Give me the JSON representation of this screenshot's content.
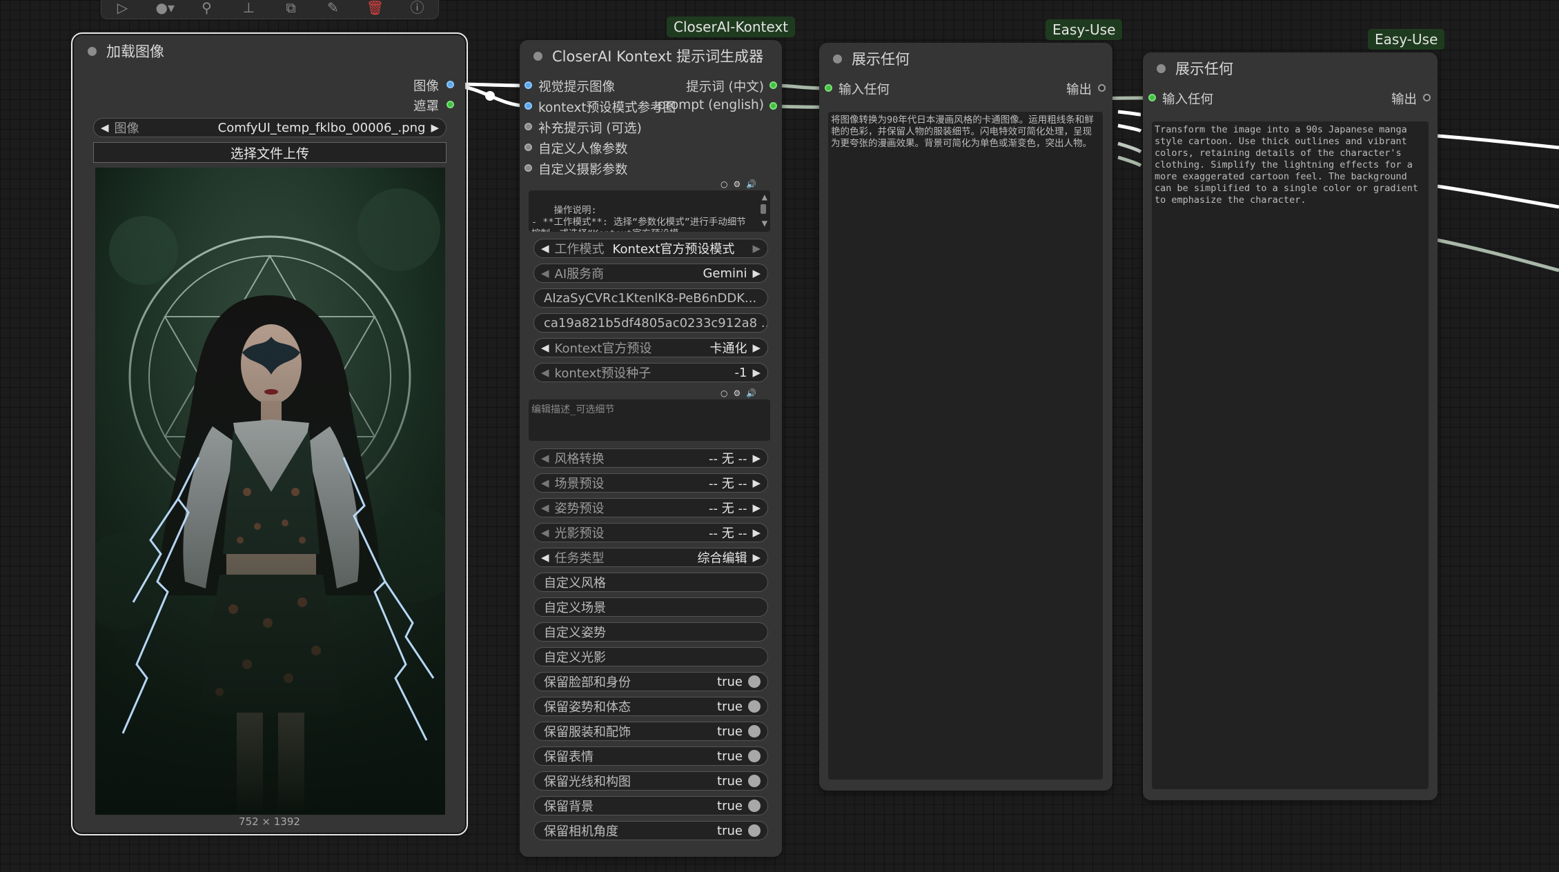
{
  "toolbar": {
    "icons": [
      "play-icon",
      "record-icon",
      "wand-icon",
      "pin-icon",
      "export-icon",
      "pencil-icon",
      "trash-icon",
      "help-icon"
    ]
  },
  "badges": {
    "kontext": "CloserAI-Kontext",
    "easy1": "Easy-Use",
    "easy2": "Easy-Use"
  },
  "load_image": {
    "title": "加载图像",
    "out_image": "图像",
    "out_mask": "遮罩",
    "image_widget_label": "图像",
    "image_widget_value": "ComfyUI_temp_fklbo_00006_.png",
    "upload_button": "选择文件上传",
    "dimensions": "752 × 1392"
  },
  "kontext_node": {
    "title": "CloserAI Kontext 提示词生成器",
    "inputs": [
      "视觉提示图像",
      "kontext预设模式参考图",
      "补充提示词 (可选)",
      "自定义人像参数",
      "自定义摄影参数"
    ],
    "outputs": [
      "提示词 (中文)",
      "prompt (english)"
    ],
    "instructions": "操作说明:\n- **工作模式**: 选择“参数化模式”进行手动细节控制，或选择“Kontext官方预设模",
    "work_mode_label": "工作模式",
    "work_mode_value": "Kontext官方预设模式",
    "ai_provider_label": "AI服务商",
    "ai_provider_value": "Gemini",
    "api_key_value": "AIzaSyCVRc1KtenlK8-PeB6nDDK...",
    "token_value": "ca19a821b5df4805ac0233c912a8 ...",
    "preset_label": "Kontext官方预设",
    "preset_value": "卡通化",
    "seed_label": "kontext预设种子",
    "seed_value": "-1",
    "edit_placeholder": "编辑描述_可选细节",
    "style_label": "风格转换",
    "style_value": "-- 无 --",
    "scene_label": "场景预设",
    "scene_value": "-- 无 --",
    "pose_label": "姿势预设",
    "pose_value": "-- 无 --",
    "light_label": "光影预设",
    "light_value": "-- 无 --",
    "task_label": "任务类型",
    "task_value": "综合编辑",
    "custom_style": "自定义风格",
    "custom_scene": "自定义场景",
    "custom_pose": "自定义姿势",
    "custom_light": "自定义光影",
    "toggles": [
      {
        "label": "保留脸部和身份",
        "value": "true"
      },
      {
        "label": "保留姿势和体态",
        "value": "true"
      },
      {
        "label": "保留服装和配饰",
        "value": "true"
      },
      {
        "label": "保留表情",
        "value": "true"
      },
      {
        "label": "保留光线和构图",
        "value": "true"
      },
      {
        "label": "保留背景",
        "value": "true"
      },
      {
        "label": "保留相机角度",
        "value": "true"
      }
    ]
  },
  "show_any_1": {
    "title": "展示任何",
    "input": "输入任何",
    "output": "输出",
    "text": "将图像转换为90年代日本漫画风格的卡通图像。运用粗线条和鲜艳的色彩，并保留人物的服装细节。闪电特效可简化处理，呈现为更夸张的漫画效果。背景可简化为单色或渐变色，突出人物。"
  },
  "show_any_2": {
    "title": "展示任何",
    "input": "输入任何",
    "output": "输出",
    "text": "Transform the image into a 90s Japanese manga style cartoon. Use thick outlines and vibrant colors, retaining details of the character's clothing. Simplify the lightning effects for a more exaggerated cartoon feel.  The background can be simplified to a single color or gradient to emphasize the character."
  },
  "colors": {
    "node_bg": "#353535",
    "badge_bg": "#1f3b1f",
    "slot_blue": "#5aa6e8",
    "slot_green": "#44c040",
    "canvas_bg": "#1c1c1c"
  }
}
